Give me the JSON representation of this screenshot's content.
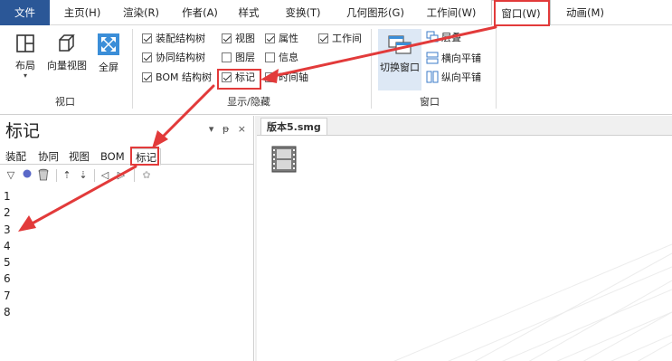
{
  "menu": {
    "file": "文件",
    "home": "主页(H)",
    "render": "渲染(R)",
    "author": "作者(A)",
    "style": "样式",
    "transform": "变换(T)",
    "geometry": "几何图形(G)",
    "workspace": "工作间(W)",
    "window": "窗口(W)",
    "animation": "动画(M)"
  },
  "ribbon": {
    "view_group": {
      "layout": "布局",
      "iso_view": "向量视图",
      "fullscreen": "全屏",
      "label": "视口"
    },
    "show_hide": {
      "label": "显示/隐藏",
      "items": [
        {
          "label": "装配结构树",
          "checked": true
        },
        {
          "label": "协同结构树",
          "checked": true
        },
        {
          "label": "BOM 结构树",
          "checked": true
        },
        {
          "label": "视图",
          "checked": true
        },
        {
          "label": "图层",
          "checked": false
        },
        {
          "label": "标记",
          "checked": true
        },
        {
          "label": "属性",
          "checked": true
        },
        {
          "label": "信息",
          "checked": false
        },
        {
          "label": "时间轴",
          "checked": true
        },
        {
          "label": "工作间",
          "checked": true
        }
      ]
    },
    "window_group": {
      "switch": "切换窗口",
      "cascade": "层叠",
      "tile_h": "横向平铺",
      "tile_v": "纵向平铺",
      "label": "窗口"
    }
  },
  "panel": {
    "title": "标记",
    "controls": [
      "▾",
      "ᵽ",
      "×"
    ],
    "tabs": [
      "装配",
      "协同",
      "视图",
      "BOM",
      "标记"
    ],
    "active_tab": "标记",
    "toolbar_icons": [
      "filter-icon",
      "dot-icon",
      "trash-icon",
      "sort-up-icon",
      "sort-down-icon",
      "prev-icon",
      "next-icon",
      "settings-icon"
    ],
    "items": [
      "1",
      "2",
      "3",
      "4",
      "5",
      "6",
      "7",
      "8"
    ]
  },
  "document": {
    "tab": "版本5.smg"
  },
  "colors": {
    "accent": "#2b5797",
    "annotation": "#e23a3a"
  }
}
